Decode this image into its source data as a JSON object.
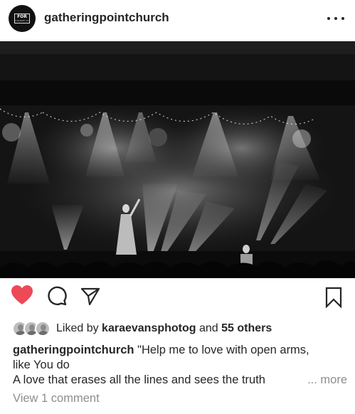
{
  "post": {
    "username": "gatheringpointchurch",
    "avatar_text_main": "FOR",
    "avatar_text_small": "KARAKEE CO"
  },
  "actions": {
    "like_icon": "heart-filled-icon",
    "comment_icon": "comment-icon",
    "share_icon": "send-icon",
    "save_icon": "bookmark-icon",
    "like_color": "#ed4956"
  },
  "likes": {
    "prefix": "Liked by",
    "user": "karaevansphotog",
    "conjunction": "and",
    "others": "55 others"
  },
  "caption": {
    "username": "gatheringpointchurch",
    "line1": "\"Help me to love with open arms,",
    "line2": "like You do",
    "line3": "A love that erases all the lines and sees the truth",
    "more": "... more"
  },
  "comments": {
    "view_label": "View 1 comment"
  }
}
